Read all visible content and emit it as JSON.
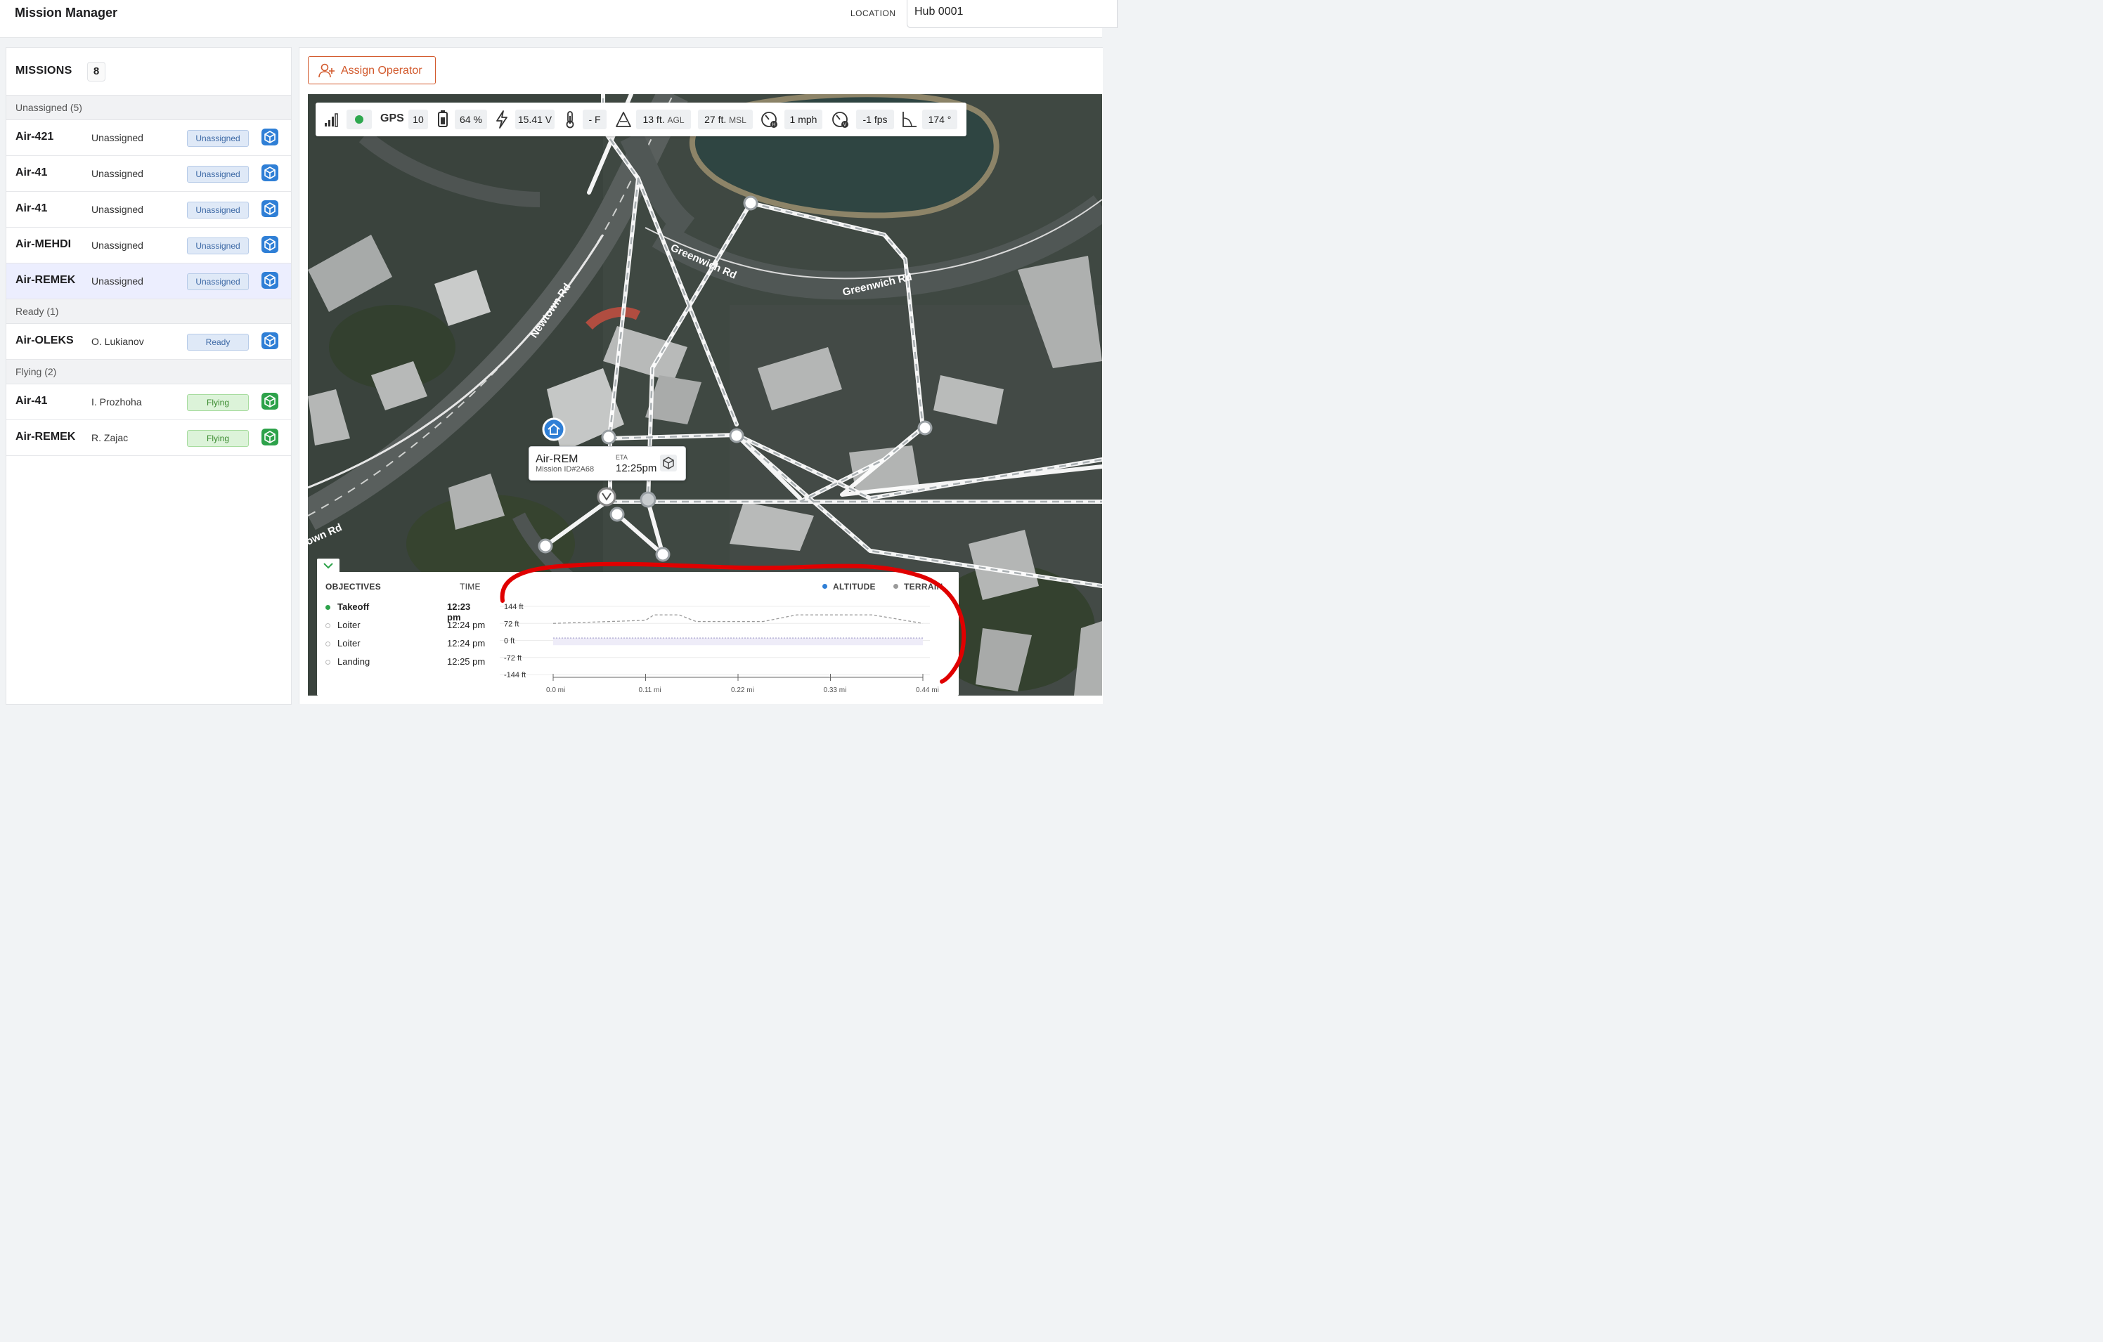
{
  "header": {
    "title": "Mission Manager",
    "location_label": "LOCATION",
    "location_value": "Hub 0001"
  },
  "missions": {
    "title": "MISSIONS",
    "count": "8",
    "groups": [
      {
        "label": "Unassigned (5)",
        "items": [
          {
            "name": "Air-421",
            "operator": "Unassigned",
            "status": "Unassigned"
          },
          {
            "name": "Air-41",
            "operator": "Unassigned",
            "status": "Unassigned"
          },
          {
            "name": "Air-41",
            "operator": "Unassigned",
            "status": "Unassigned"
          },
          {
            "name": "Air-MEHDI",
            "operator": "Unassigned",
            "status": "Unassigned"
          },
          {
            "name": "Air-REMEK",
            "operator": "Unassigned",
            "status": "Unassigned"
          }
        ]
      },
      {
        "label": "Ready (1)",
        "items": [
          {
            "name": "Air-OLEKS",
            "operator": "O. Lukianov",
            "status": "Ready"
          }
        ]
      },
      {
        "label": "Flying (2)",
        "items": [
          {
            "name": "Air-41",
            "operator": "I. Prozhoha",
            "status": "Flying"
          },
          {
            "name": "Air-REMEK",
            "operator": "R. Zajac",
            "status": "Flying"
          }
        ]
      }
    ]
  },
  "toolbar": {
    "assign_label": "Assign Operator"
  },
  "telemetry": {
    "gps_label": "GPS",
    "gps_count": "10",
    "battery": "64 %",
    "voltage": "15.41 V",
    "temperature": "- F",
    "altitude_agl": "13 ft.",
    "agl_unit": "AGL",
    "altitude_msl": "27 ft.",
    "msl_unit": "MSL",
    "hspeed": "1 mph",
    "vspeed": "-1 fps",
    "heading": "174 °",
    "status_color": "#2fa84f"
  },
  "map": {
    "labels": {
      "greenwich_1": "Greenwich Rd",
      "greenwich_2": "Greenwich Rd",
      "newtown": "Newtown Rd",
      "own_rd": "own Rd"
    }
  },
  "popup": {
    "name": "Air-REM",
    "mission_id": "Mission ID#2A68",
    "eta_label": "ETA",
    "eta": "12:25pm"
  },
  "objectives": {
    "title": "OBJECTIVES",
    "time_title": "TIME",
    "items": [
      {
        "name": "Takeoff",
        "time": "12:23 pm",
        "active": true
      },
      {
        "name": "Loiter",
        "time": "12:24 pm",
        "active": false
      },
      {
        "name": "Loiter",
        "time": "12:24 pm",
        "active": false
      },
      {
        "name": "Landing",
        "time": "12:25 pm",
        "active": false
      }
    ]
  },
  "chart_data": {
    "type": "line",
    "legend": [
      "ALTITUDE",
      "TERRAIN"
    ],
    "colors": {
      "altitude": "#2f7fd6",
      "terrain": "#9a9a9a"
    },
    "ytick_labels": [
      "144 ft",
      "72 ft",
      "0 ft",
      "-72 ft",
      "-144 ft"
    ],
    "xtick_labels": [
      "0.0 mi",
      "0.11 mi",
      "0.22 mi",
      "0.33 mi",
      "0.44 mi"
    ],
    "ylim": [
      -144,
      144
    ],
    "xlim": [
      0,
      0.44
    ],
    "series": [
      {
        "name": "ALTITUDE",
        "x": [
          0,
          0.44
        ],
        "y": [
          10,
          10
        ]
      },
      {
        "name": "TERRAIN",
        "x": [
          0,
          0.11,
          0.12,
          0.15,
          0.17,
          0.25,
          0.29,
          0.3,
          0.38,
          0.44
        ],
        "y": [
          72,
          85,
          108,
          108,
          80,
          80,
          108,
          108,
          108,
          72
        ]
      }
    ]
  }
}
